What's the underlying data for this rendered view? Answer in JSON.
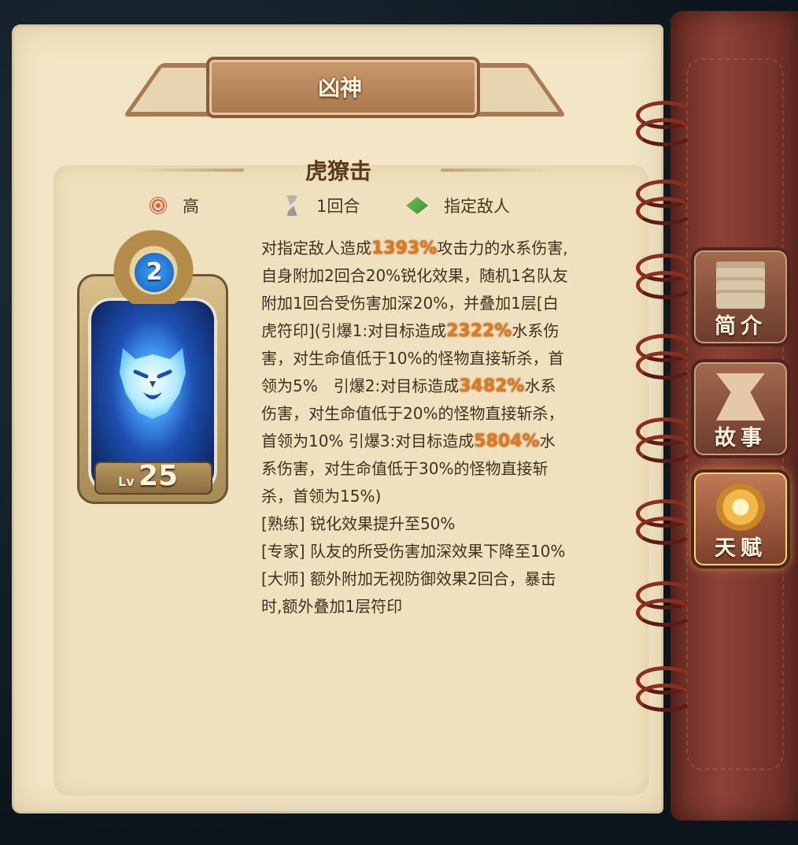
{
  "header": {
    "title": "凶神"
  },
  "skill": {
    "name": "虎獠击",
    "stats": [
      {
        "icon": "target-icon",
        "label": "高"
      },
      {
        "icon": "turn-icon",
        "label": "1回合"
      },
      {
        "icon": "tile-icon",
        "label": "指定敌人"
      }
    ]
  },
  "card": {
    "badge": "2",
    "level_prefix": "Lv",
    "level": "25"
  },
  "description": {
    "p1_before": "对指定敌人造成",
    "p1_value": "1393%",
    "p1_after": "攻击力的水系伤害,自身附加2回合20%锐化效果，随机1名队友附加1回合受伤害加深20%，并叠加1层[白虎符印](引爆1:对目标造成",
    "p2_value": "2322%",
    "p2_after": "水系伤害，对生命值低于10%的怪物直接斩杀，首领为5%　引爆2:对目标造成",
    "p3_value": "3482%",
    "p3_after": "水系伤害，对生命值低于20%的怪物直接斩杀，首领为10% 引爆3:对目标造成",
    "p4_value": "5804%",
    "p4_after": "水系伤害，对生命值低于30%的怪物直接斩杀，首领为15%)",
    "mastery": [
      "[熟练] 锐化效果提升至50%",
      "[专家] 队友的所受伤害加深效果下降至10%",
      "[大师] 额外附加无视防御效果2回合，暴击时,额外叠加1层符印"
    ],
    "highlight_color": "#e07a1e"
  },
  "tabs": [
    {
      "label": "简介",
      "icon": "document-icon",
      "active": false
    },
    {
      "label": "故事",
      "icon": "story-icon",
      "active": false
    },
    {
      "label": "天赋",
      "icon": "talent-icon",
      "active": true
    }
  ]
}
